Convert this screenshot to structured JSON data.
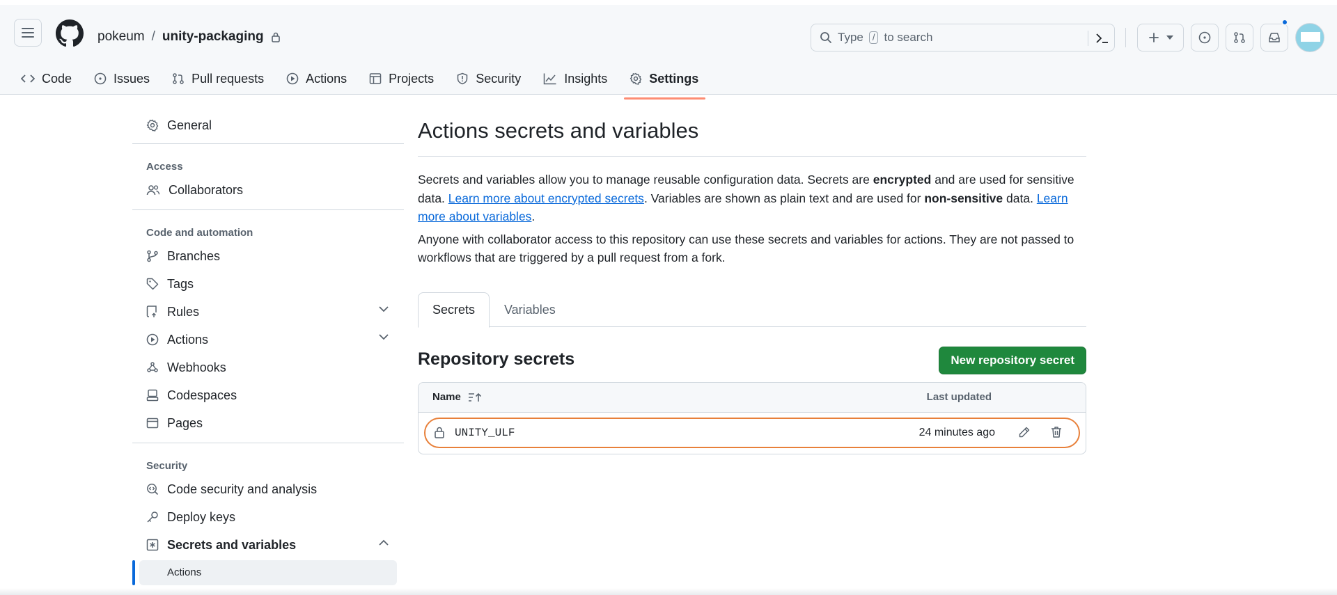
{
  "header": {
    "owner": "pokeum",
    "separator": "/",
    "repo": "unity-packaging",
    "search_pre": "Type",
    "search_key": "/",
    "search_post": "to search"
  },
  "tabs": [
    {
      "label": "Code",
      "icon": "code-icon"
    },
    {
      "label": "Issues",
      "icon": "issue-icon"
    },
    {
      "label": "Pull requests",
      "icon": "pull-request-icon"
    },
    {
      "label": "Actions",
      "icon": "play-icon"
    },
    {
      "label": "Projects",
      "icon": "table-icon"
    },
    {
      "label": "Security",
      "icon": "shield-icon"
    },
    {
      "label": "Insights",
      "icon": "graph-icon"
    },
    {
      "label": "Settings",
      "icon": "gear-icon",
      "active": true
    }
  ],
  "sidebar": {
    "general": "General",
    "access_heading": "Access",
    "collaborators": "Collaborators",
    "code_heading": "Code and automation",
    "branches": "Branches",
    "tags": "Tags",
    "rules": "Rules",
    "actions": "Actions",
    "webhooks": "Webhooks",
    "codespaces": "Codespaces",
    "pages": "Pages",
    "security_heading": "Security",
    "code_security": "Code security and analysis",
    "deploy_keys": "Deploy keys",
    "secrets_variables": "Secrets and variables",
    "sub_actions": "Actions"
  },
  "main": {
    "title": "Actions secrets and variables",
    "p1_a": "Secrets and variables allow you to manage reusable configuration data. Secrets are ",
    "p1_b": "encrypted",
    "p1_c": " and are used for sensitive data. ",
    "p1_link1": "Learn more about encrypted secrets",
    "p1_d": ". Variables are shown as plain text and are used for ",
    "p1_e": "non-sensitive",
    "p1_f": " data. ",
    "p1_link2": "Learn more about variables",
    "p1_g": ".",
    "p2": "Anyone with collaborator access to this repository can use these secrets and variables for actions. They are not passed to workflows that are triggered by a pull request from a fork.",
    "tab_secrets": "Secrets",
    "tab_variables": "Variables",
    "section_title": "Repository secrets",
    "new_button": "New repository secret",
    "col_name": "Name",
    "col_updated": "Last updated",
    "secrets": [
      {
        "name": "UNITY_ULF",
        "updated": "24 minutes ago"
      }
    ]
  },
  "colors": {
    "accent": "#fd8c73",
    "primary_button": "#1f883d",
    "link": "#0969da",
    "highlight": "#e8803a"
  }
}
